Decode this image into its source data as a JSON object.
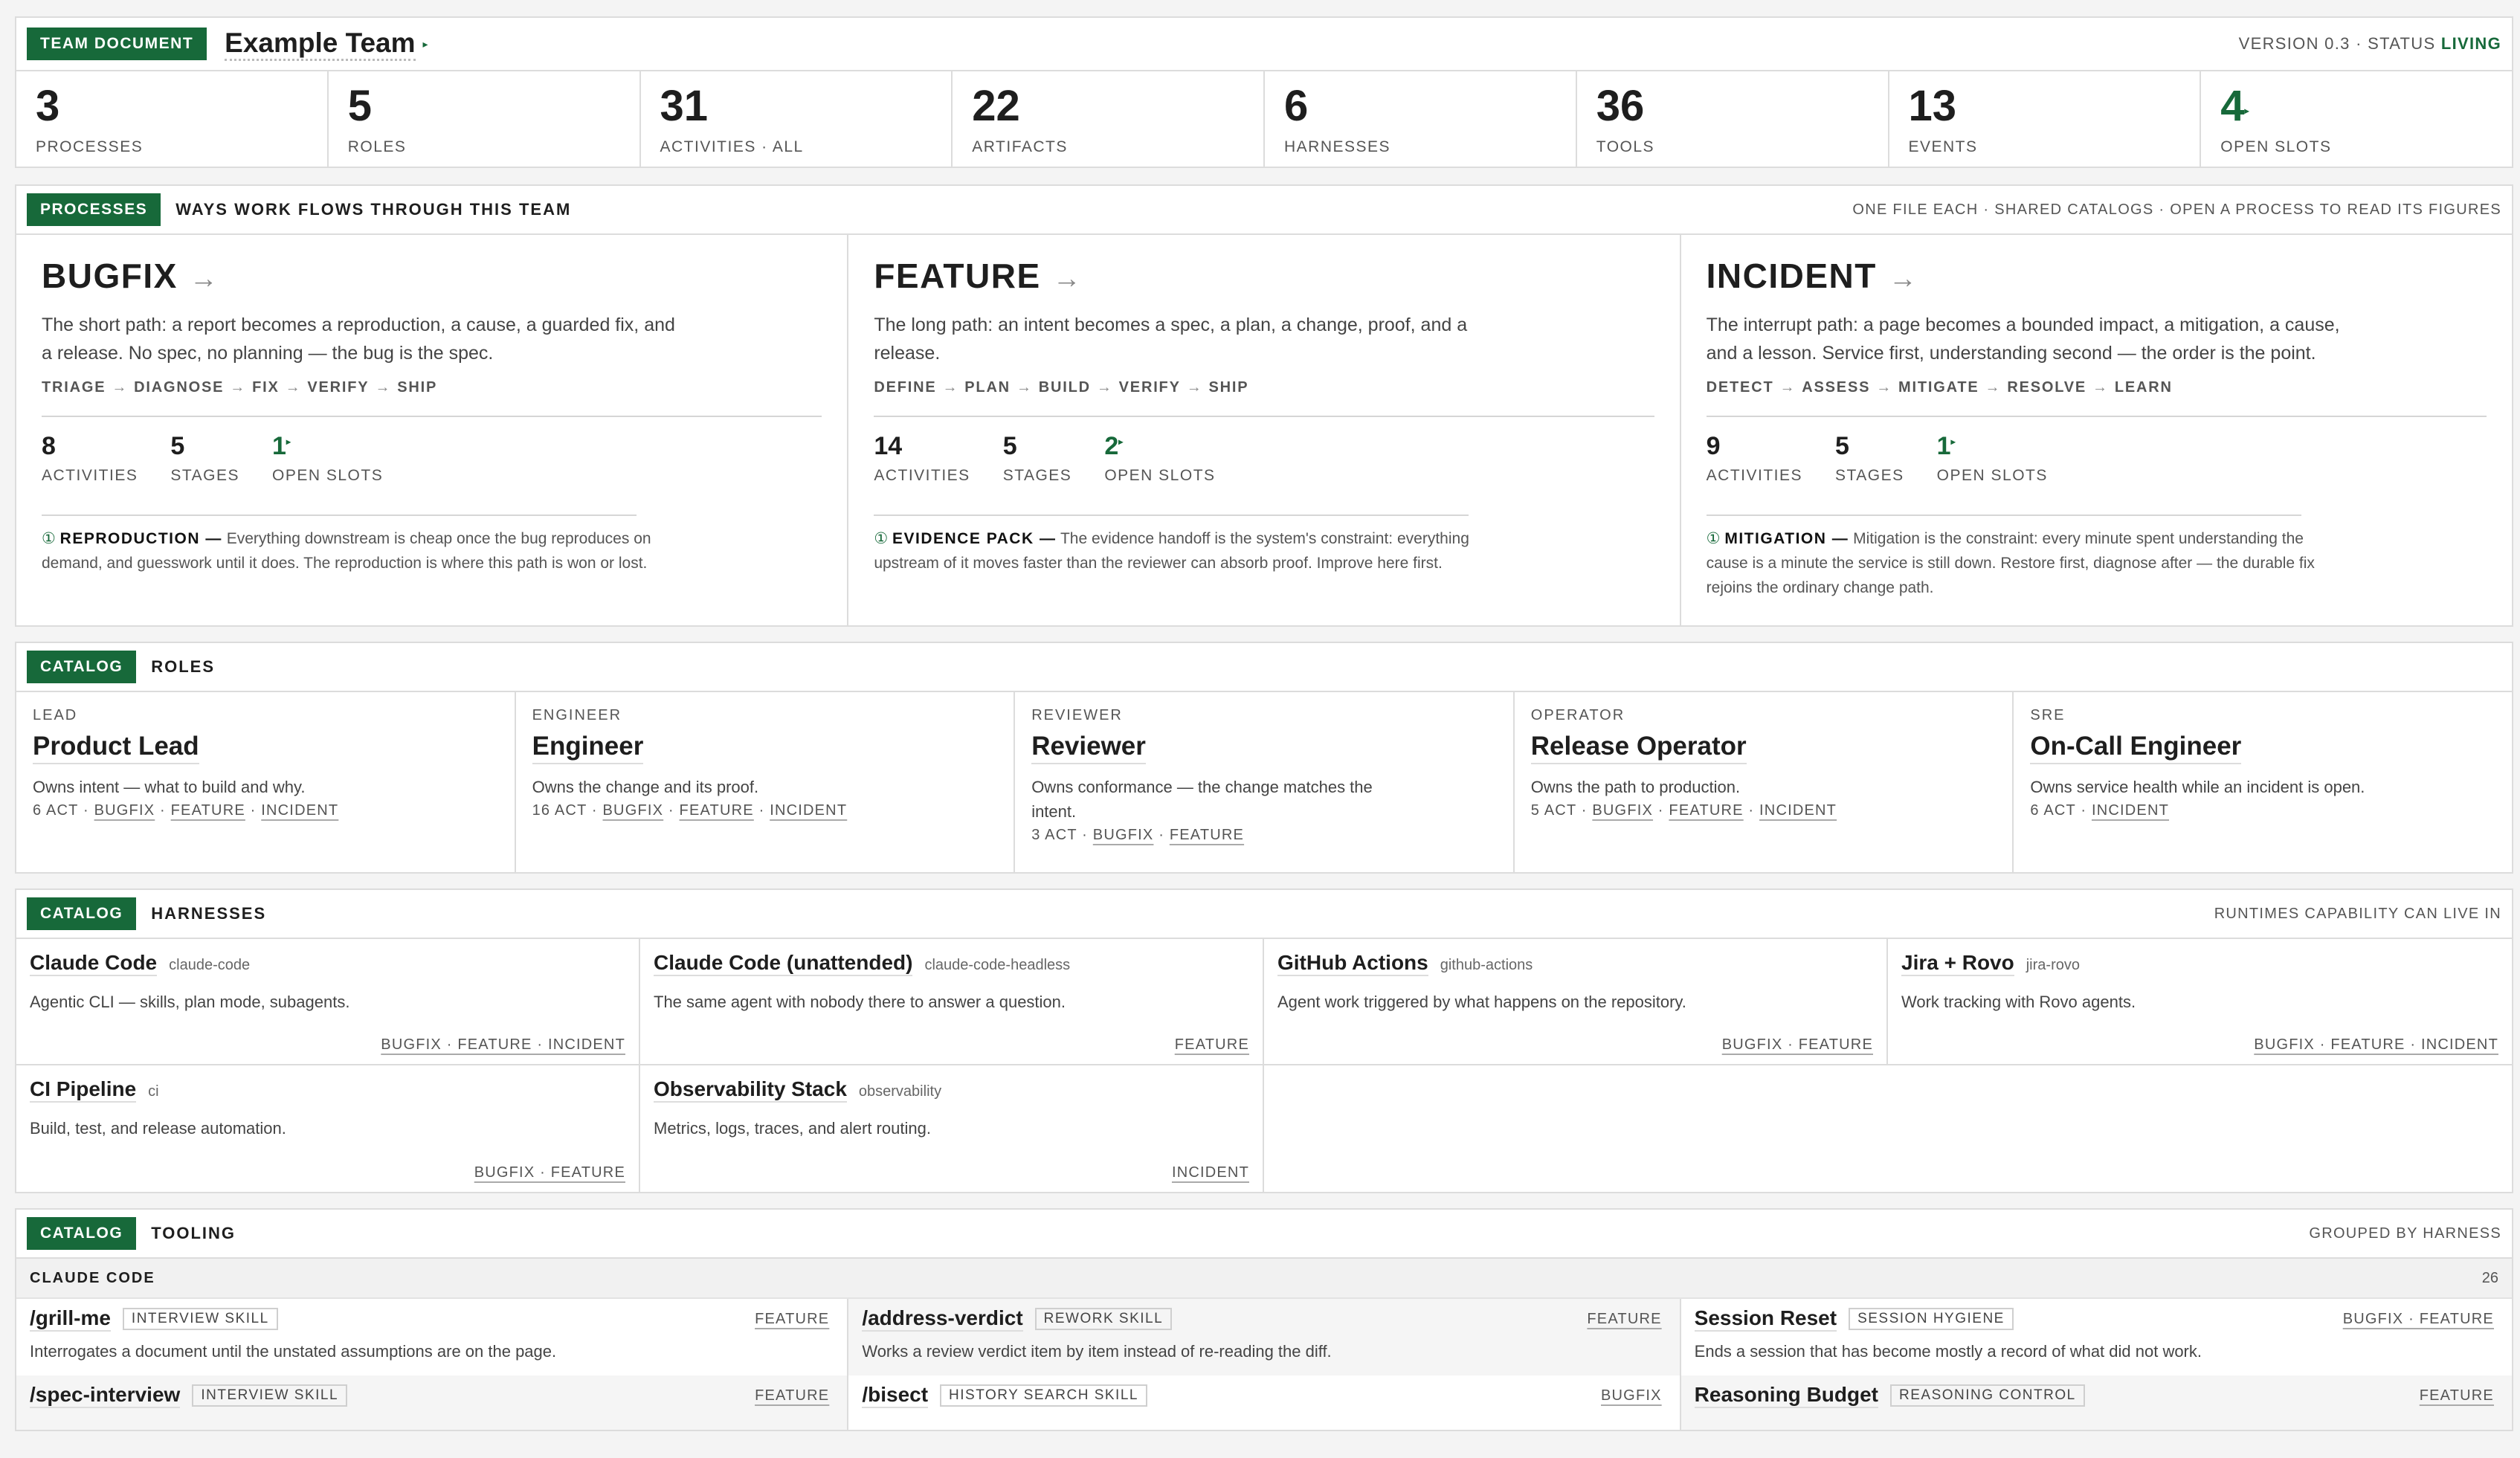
{
  "header": {
    "badge": "TEAM DOCUMENT",
    "team_name": "Example Team",
    "version_label": "VERSION 0.3 · STATUS",
    "status": "LIVING"
  },
  "stats": [
    {
      "value": "3",
      "label": "PROCESSES"
    },
    {
      "value": "5",
      "label": "ROLES"
    },
    {
      "value": "31",
      "label": "ACTIVITIES · ALL"
    },
    {
      "value": "22",
      "label": "ARTIFACTS"
    },
    {
      "value": "6",
      "label": "HARNESSES"
    },
    {
      "value": "36",
      "label": "TOOLS"
    },
    {
      "value": "13",
      "label": "EVENTS"
    },
    {
      "value": "4",
      "label": "OPEN SLOTS"
    }
  ],
  "processes": {
    "badge": "PROCESSES",
    "title": "WAYS WORK FLOWS THROUGH THIS TEAM",
    "right": "ONE FILE EACH · SHARED CATALOGS · OPEN A PROCESS TO READ ITS FIGURES",
    "items": [
      {
        "name": "BUGFIX",
        "desc": "The short path: a report becomes a reproduction, a cause, a guarded fix, and a release. No spec, no planning — the bug is the spec.",
        "flow": [
          "TRIAGE",
          "DIAGNOSE",
          "FIX",
          "VERIFY",
          "SHIP"
        ],
        "activities": "8",
        "stages": "5",
        "open_slots": "1",
        "note_num": "①",
        "note_title": "REPRODUCTION —",
        "note": "Everything downstream is cheap once the bug reproduces on demand, and guesswork until it does. The reproduction is where this path is won or lost."
      },
      {
        "name": "FEATURE",
        "desc": "The long path: an intent becomes a spec, a plan, a change, proof, and a release.",
        "flow": [
          "DEFINE",
          "PLAN",
          "BUILD",
          "VERIFY",
          "SHIP"
        ],
        "activities": "14",
        "stages": "5",
        "open_slots": "2",
        "note_num": "①",
        "note_title": "EVIDENCE PACK —",
        "note": "The evidence handoff is the system's constraint: everything upstream of it moves faster than the reviewer can absorb proof. Improve here first."
      },
      {
        "name": "INCIDENT",
        "desc": "The interrupt path: a page becomes a bounded impact, a mitigation, a cause, and a lesson. Service first, understanding second — the order is the point.",
        "flow": [
          "DETECT",
          "ASSESS",
          "MITIGATE",
          "RESOLVE",
          "LEARN"
        ],
        "activities": "9",
        "stages": "5",
        "open_slots": "1",
        "note_num": "①",
        "note_title": "MITIGATION —",
        "note": "Mitigation is the constraint: every minute spent understanding the cause is a minute the service is still down. Restore first, diagnose after — the durable fix rejoins the ordinary change path."
      }
    ],
    "labels": {
      "activities": "ACTIVITIES",
      "stages": "STAGES",
      "open_slots": "OPEN SLOTS"
    }
  },
  "roles": {
    "badge": "CATALOG",
    "title": "ROLES",
    "items": [
      {
        "kind": "LEAD",
        "name": "Product Lead",
        "desc": "Owns intent — what to build and why.",
        "act": "6 ACT",
        "links": [
          "BUGFIX",
          "FEATURE",
          "INCIDENT"
        ]
      },
      {
        "kind": "ENGINEER",
        "name": "Engineer",
        "desc": "Owns the change and its proof.",
        "act": "16 ACT",
        "links": [
          "BUGFIX",
          "FEATURE",
          "INCIDENT"
        ]
      },
      {
        "kind": "REVIEWER",
        "name": "Reviewer",
        "desc": "Owns conformance — the change matches the intent.",
        "act": "3 ACT",
        "links": [
          "BUGFIX",
          "FEATURE"
        ]
      },
      {
        "kind": "OPERATOR",
        "name": "Release Operator",
        "desc": "Owns the path to production.",
        "act": "5 ACT",
        "links": [
          "BUGFIX",
          "FEATURE",
          "INCIDENT"
        ]
      },
      {
        "kind": "SRE",
        "name": "On-Call Engineer",
        "desc": "Owns service health while an incident is open.",
        "act": "6 ACT",
        "links": [
          "INCIDENT"
        ]
      }
    ]
  },
  "harnesses": {
    "badge": "CATALOG",
    "title": "HARNESSES",
    "right": "RUNTIMES CAPABILITY CAN LIVE IN",
    "items": [
      {
        "name": "Claude Code",
        "slug": "claude-code",
        "desc": "Agentic CLI — skills, plan mode, subagents.",
        "links": "BUGFIX · FEATURE · INCIDENT"
      },
      {
        "name": "Claude Code (unattended)",
        "slug": "claude-code-headless",
        "desc": "The same agent with nobody there to answer a question.",
        "links": "FEATURE"
      },
      {
        "name": "GitHub Actions",
        "slug": "github-actions",
        "desc": "Agent work triggered by what happens on the repository.",
        "links": "BUGFIX · FEATURE"
      },
      {
        "name": "Jira + Rovo",
        "slug": "jira-rovo",
        "desc": "Work tracking with Rovo agents.",
        "links": "BUGFIX · FEATURE · INCIDENT"
      },
      {
        "name": "CI Pipeline",
        "slug": "ci",
        "desc": "Build, test, and release automation.",
        "links": "BUGFIX · FEATURE"
      },
      {
        "name": "Observability Stack",
        "slug": "observability",
        "desc": "Metrics, logs, traces, and alert routing.",
        "links": "INCIDENT"
      }
    ]
  },
  "tooling": {
    "badge": "CATALOG",
    "title": "TOOLING",
    "right": "GROUPED BY HARNESS",
    "group": {
      "name": "CLAUDE CODE",
      "count": "26"
    },
    "columns": [
      [
        {
          "name": "/grill-me",
          "chip": "INTERVIEW SKILL",
          "tag": "FEATURE",
          "desc": "Interrogates a document until the unstated assumptions are on the page."
        },
        {
          "name": "/spec-interview",
          "chip": "INTERVIEW SKILL",
          "tag": "FEATURE",
          "desc": ""
        }
      ],
      [
        {
          "name": "/address-verdict",
          "chip": "REWORK SKILL",
          "tag": "FEATURE",
          "desc": "Works a review verdict item by item instead of re-reading the diff."
        },
        {
          "name": "/bisect",
          "chip": "HISTORY SEARCH SKILL",
          "tag": "BUGFIX",
          "desc": ""
        }
      ],
      [
        {
          "name": "Session Reset",
          "chip": "SESSION HYGIENE",
          "tag": "BUGFIX · FEATURE",
          "desc": "Ends a session that has become mostly a record of what did not work."
        },
        {
          "name": "Reasoning Budget",
          "chip": "REASONING CONTROL",
          "tag": "FEATURE",
          "desc": ""
        }
      ]
    ]
  },
  "colors": {
    "accent": "#17693a",
    "border": "#dcdcdc",
    "muted": "#555555"
  }
}
